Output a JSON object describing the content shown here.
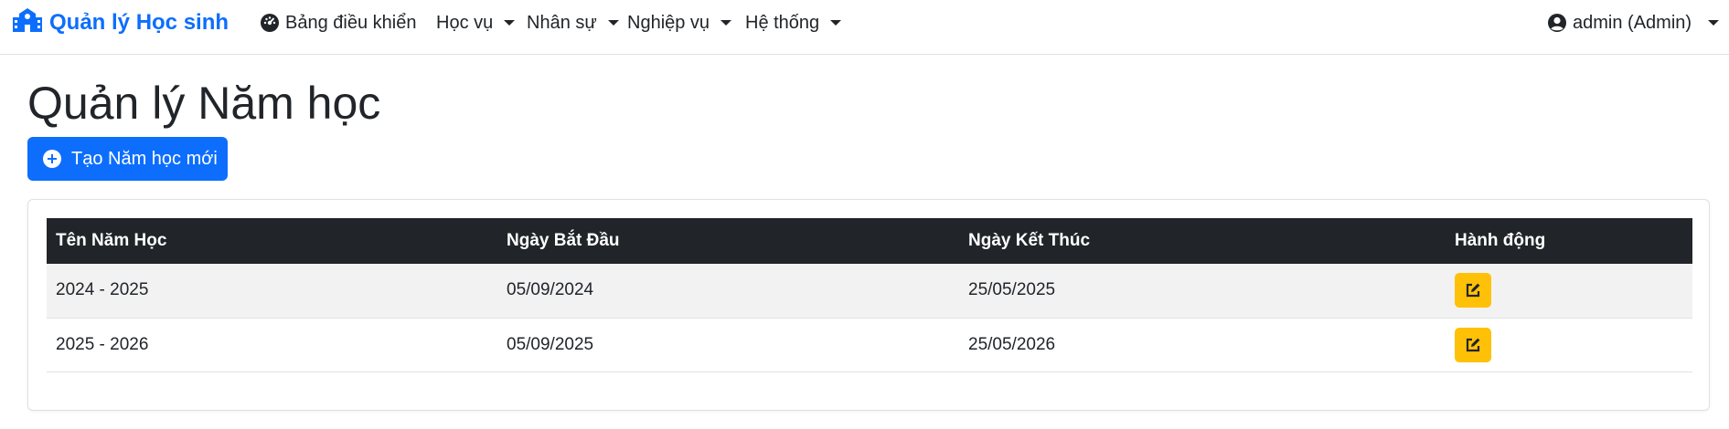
{
  "navbar": {
    "brand": {
      "label": "Quản lý Học sinh",
      "icon": "school-icon"
    },
    "items": [
      {
        "label": "Bảng điều khiển",
        "icon": "dashboard-gauge-icon",
        "dropdown": false
      },
      {
        "label": "Học vụ",
        "dropdown": true
      },
      {
        "label": "Nhân sự",
        "dropdown": true
      },
      {
        "label": "Nghiệp vụ",
        "dropdown": true
      },
      {
        "label": "Hệ thống",
        "dropdown": true
      }
    ],
    "user": {
      "label": "admin (Admin)",
      "icon": "user-circle-icon",
      "dropdown": true
    }
  },
  "page": {
    "title": "Quản lý Năm học",
    "create_button": {
      "label": "Tạo Năm học mới",
      "icon": "plus-circle-icon"
    }
  },
  "table": {
    "headers": [
      "Tên Năm Học",
      "Ngày Bắt Đầu",
      "Ngày Kết Thúc",
      "Hành động"
    ],
    "rows": [
      {
        "name": "2024 - 2025",
        "start": "05/09/2024",
        "end": "25/05/2025",
        "action_icon": "edit-icon"
      },
      {
        "name": "2025 - 2026",
        "start": "05/09/2025",
        "end": "25/05/2026",
        "action_icon": "edit-icon"
      }
    ]
  },
  "colors": {
    "primary": "#0d6efd",
    "warning": "#ffc107",
    "header_dark": "#212529",
    "row_stripe": "#f2f2f2"
  }
}
